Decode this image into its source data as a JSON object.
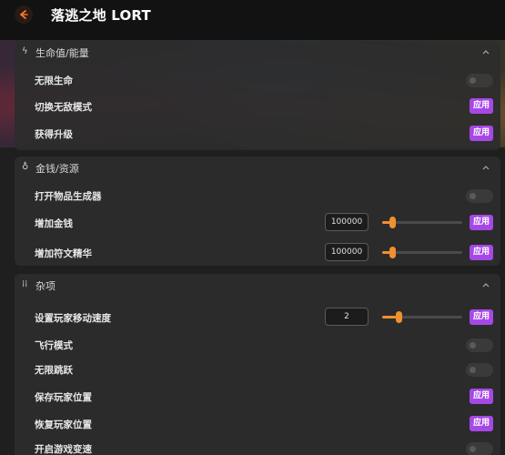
{
  "app": {
    "title": "落逃之地 LORT"
  },
  "sections": [
    {
      "icon": "lightning-icon",
      "icon_glyph": "ϟ",
      "title": "生命值/能量",
      "rows": [
        {
          "label": "无限生命",
          "control": "toggle"
        },
        {
          "label": "切换无敌模式",
          "control": "apply",
          "button": "应用"
        },
        {
          "label": "获得升级",
          "control": "apply",
          "button": "应用"
        }
      ]
    },
    {
      "icon": "coin-bag-icon",
      "icon_glyph": "♁",
      "title": "金钱/资源",
      "rows": [
        {
          "label": "打开物品生成器",
          "control": "toggle"
        },
        {
          "label": "增加金钱",
          "control": "number",
          "value": "100000",
          "slider_fraction": 0.12,
          "button": "应用"
        },
        {
          "label": "增加符文精华",
          "control": "number",
          "value": "100000",
          "slider_fraction": 0.12,
          "button": "应用"
        }
      ]
    },
    {
      "icon": "grid-icon",
      "icon_glyph": "⁞⁞",
      "title": "杂项",
      "rows": [
        {
          "label": "设置玩家移动速度",
          "control": "number",
          "value": "2",
          "slider_fraction": 0.2,
          "button": "应用"
        },
        {
          "label": "飞行模式",
          "control": "toggle"
        },
        {
          "label": "无限跳跃",
          "control": "toggle"
        },
        {
          "label": "保存玩家位置",
          "control": "apply",
          "button": "应用"
        },
        {
          "label": "恢复玩家位置",
          "control": "apply",
          "button": "应用"
        },
        {
          "label": "开启游戏变速",
          "control": "toggle"
        }
      ]
    }
  ]
}
